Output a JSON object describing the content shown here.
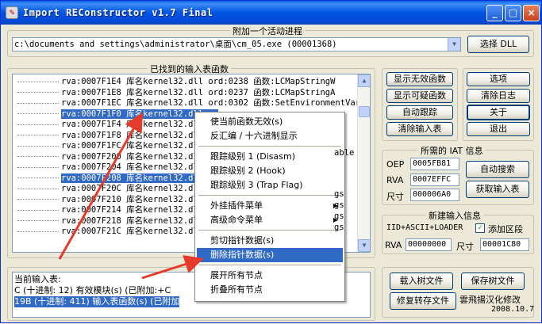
{
  "window": {
    "title": "Import REConstructor v1.7 Final",
    "app_icon": "ir-app-icon",
    "minimize_glyph": "_",
    "maximize_glyph": "□",
    "close_glyph": "×"
  },
  "process_group": {
    "label": "附加一个活动进程",
    "process_value": "c:\\documents and settings\\administrator\\桌面\\cm_05.exe (00001368)",
    "dropdown_glyph": "▼",
    "select_dll_label": "选择 DLL"
  },
  "imports_group": {
    "label": "已找到的输入表函数",
    "rows": [
      {
        "text": "rva:0007F1E4 库名kernel32.dll ord:0238 函数:LCMapStringW",
        "selected": false
      },
      {
        "text": "rva:0007F1E8 库名kernel32.dll ord:0237 函数:LCMapStringA",
        "selected": false
      },
      {
        "text": "rva:0007F1EC 库名kernel32.dll ord:0302 函数:SetEnvironmentVariable",
        "selected": false
      },
      {
        "text": "rva:0007F1F0 库名kernel32.dll or",
        "selected": true
      },
      {
        "text": "rva:0007F1F4 库名kernel32.dll or",
        "selected": false
      },
      {
        "text": "rva:0007F1F8 库名kernel32.dll or",
        "selected": false
      },
      {
        "text": "rva:0007F1FC 库名kernel32.dll or",
        "selected": false
      },
      {
        "text": "rva:0007F200 库名kernel32.dll or",
        "selected": false
      },
      {
        "text": "rva:0007F204 库名kernel32.dll or",
        "selected": false
      },
      {
        "text": "rva:0007F208 库名kernel32.dll or",
        "selected": true
      },
      {
        "text": "rva:0007F20C 库名kernel32.dll or",
        "selected": false
      },
      {
        "text": "rva:0007F210 库名kernel32.dll or",
        "selected": false
      },
      {
        "text": "rva:0007F214 库名kernel32.dll or",
        "selected": false
      },
      {
        "text": "rva:0007F218 库名kernel32.dll or",
        "selected": false
      },
      {
        "text": "rva:0007F21C 库名kernel32.dll or",
        "selected": false
      }
    ],
    "right_overflow": [
      "able",
      "gs",
      "gs",
      "gs",
      "gs"
    ]
  },
  "actions": {
    "show_invalid": "显示无效函数",
    "show_suspicious": "显示可疑函数",
    "auto_trace": "自动跟踪",
    "clear_imports": "清除输入表"
  },
  "side_buttons": {
    "options": "选项",
    "clear_log": "清除日志",
    "about": "关于",
    "exit": "退出"
  },
  "iat_group": {
    "label": "所需的 IAT 信息",
    "oep_label": "OEP",
    "oep_value": "0005FB81",
    "rva_label": "RVA",
    "rva_value": "0007EFFC",
    "size_label": "尺寸",
    "size_value": "000006A0",
    "auto_search": "自动搜索",
    "get_imports": "获取输入表"
  },
  "new_import_group": {
    "label": "新建输入信息",
    "iid_label": "IID+ASCII+LOADER",
    "add_section_label": "添加区段",
    "add_section_checked": true,
    "rva_label": "RVA",
    "rva_value": "00000000",
    "size_label": "尺寸",
    "size_value": "00001C80"
  },
  "log_group": {
    "label": "记",
    "lines": [
      {
        "text": "当前输入表:",
        "selected": false
      },
      {
        "text": "C (十进制: 12) 有效模块(s) (已附加:+C",
        "selected": false
      },
      {
        "text": "19B (十进制: 411) 输入表函数(s) (已附加",
        "selected": true
      }
    ]
  },
  "tree_buttons": {
    "load_tree": "载入树文件",
    "save_tree": "保存树文件",
    "fix_dump": "修复转存文件"
  },
  "credits": {
    "line1": "雲飛揚汉化修改",
    "line2": "2008.10.7"
  },
  "context_menu": {
    "items": [
      {
        "label": "使当前函数无效(s)",
        "submenu": false,
        "highlight": false
      },
      {
        "label": "反汇编 / 十六进制显示",
        "submenu": false,
        "highlight": false
      },
      {
        "sep": true
      },
      {
        "label": "跟踪级别  1  (Disasm)",
        "submenu": false,
        "highlight": false
      },
      {
        "label": "跟踪级别  2  (Hook)",
        "submenu": false,
        "highlight": false
      },
      {
        "label": "跟踪级别  3  (Trap Flag)",
        "submenu": false,
        "highlight": false
      },
      {
        "sep": true
      },
      {
        "label": "外挂插件菜单",
        "submenu": true,
        "highlight": false
      },
      {
        "label": "高级命令菜单",
        "submenu": true,
        "highlight": false
      },
      {
        "sep": true
      },
      {
        "label": "剪切指针数据(s)",
        "submenu": false,
        "highlight": false
      },
      {
        "label": "删除指针数据(s)",
        "submenu": false,
        "highlight": true
      },
      {
        "sep": true
      },
      {
        "label": "展开所有节点",
        "submenu": false,
        "highlight": false
      },
      {
        "label": "折叠所有节点",
        "submenu": false,
        "highlight": false
      }
    ],
    "submenu_glyph": "▶"
  },
  "annotation_color": "#e63a2a"
}
